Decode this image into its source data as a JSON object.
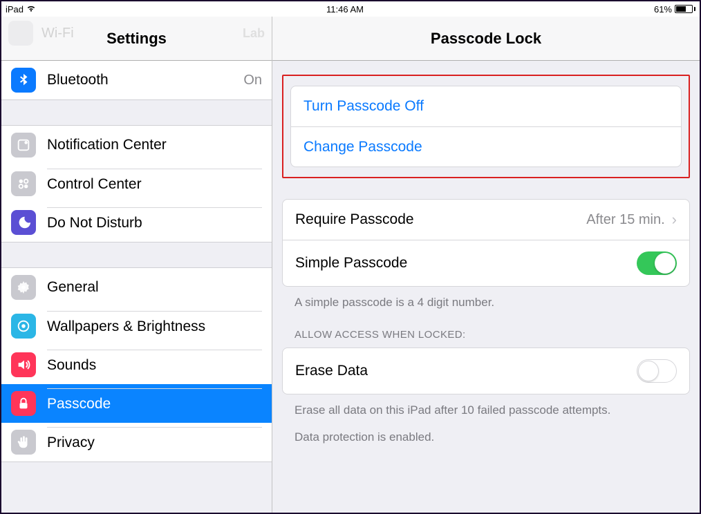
{
  "statusbar": {
    "device": "iPad",
    "time": "11:46 AM",
    "battery_pct": "61%"
  },
  "sidebar": {
    "title": "Settings",
    "faded": {
      "label": "Wi-Fi",
      "value": "Lab"
    },
    "groups": [
      [
        {
          "label": "Bluetooth",
          "value": "On"
        }
      ],
      [
        {
          "label": "Notification Center"
        },
        {
          "label": "Control Center"
        },
        {
          "label": "Do Not Disturb"
        }
      ],
      [
        {
          "label": "General"
        },
        {
          "label": "Wallpapers & Brightness"
        },
        {
          "label": "Sounds"
        },
        {
          "label": "Passcode"
        },
        {
          "label": "Privacy"
        }
      ]
    ]
  },
  "detail": {
    "title": "Passcode Lock",
    "actions": {
      "turn_off": "Turn Passcode Off",
      "change": "Change Passcode"
    },
    "require": {
      "label": "Require Passcode",
      "value": "After 15 min."
    },
    "simple": {
      "label": "Simple Passcode",
      "note": "A simple passcode is a 4 digit number."
    },
    "allow_header": "ALLOW ACCESS WHEN LOCKED:",
    "erase": {
      "label": "Erase Data",
      "note1": "Erase all data on this iPad after 10 failed passcode attempts.",
      "note2": "Data protection is enabled."
    }
  }
}
